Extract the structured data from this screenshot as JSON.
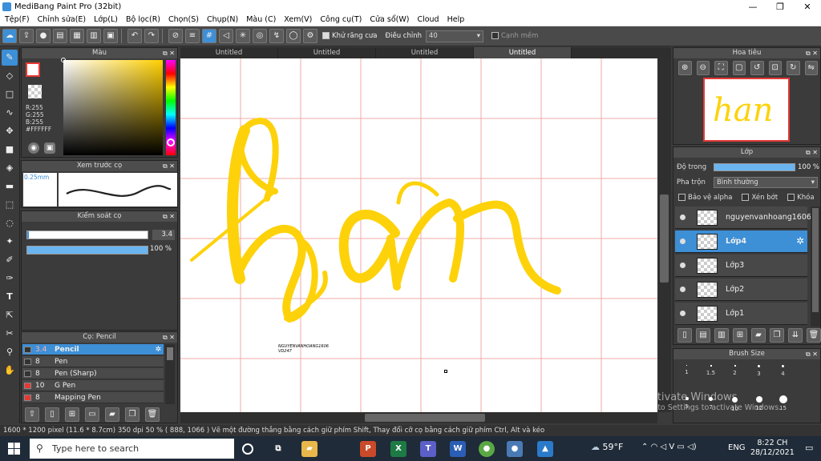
{
  "title": "MediBang Paint Pro (32bit)",
  "menu": [
    "Tệp(F)",
    "Chỉnh sửa(E)",
    "Lớp(L)",
    "Bộ lọc(R)",
    "Chọn(S)",
    "Chụp(N)",
    "Màu (C)",
    "Xem(V)",
    "Công cụ(T)",
    "Cửa sổ(W)",
    "Cloud",
    "Help"
  ],
  "toolbar": {
    "antialias": "Khử răng cưa",
    "adjust_label": "Điều chỉnh",
    "adjust_value": "40",
    "edge": "Cạnh mềm"
  },
  "tabs": [
    "Untitled",
    "Untitled",
    "Untitled",
    "Untitled"
  ],
  "color_panel": {
    "title": "Màu",
    "r": "R:255",
    "g": "G:255",
    "b": "B:255",
    "hex": "#FFFFFF"
  },
  "preview_panel": {
    "title": "Xem trước cọ",
    "size": "0.25mm"
  },
  "brush_ctrl": {
    "title": "Kiểm soát cọ",
    "size": "3.4",
    "opacity": "100 %"
  },
  "brush_list": {
    "title": "Cọ: Pencil",
    "items": [
      {
        "size": "3.4",
        "name": "Pencil",
        "color": "#2b2b2b"
      },
      {
        "size": "8",
        "name": "Pen",
        "color": "#2b2b2b"
      },
      {
        "size": "8",
        "name": "Pen (Sharp)",
        "color": "#2b2b2b"
      },
      {
        "size": "10",
        "name": "G Pen",
        "color": "#e53935"
      },
      {
        "size": "8",
        "name": "Mapping Pen",
        "color": "#e53935"
      }
    ]
  },
  "navigator": {
    "title": "Hoa tiêu"
  },
  "layers": {
    "title": "Lớp",
    "opacity_label": "Độ trong",
    "opacity_value": "100 %",
    "blend_label": "Pha trộn",
    "blend_value": "Bình thường",
    "protect_alpha": "Bảo vệ alpha",
    "clip": "Xén bớt",
    "lock": "Khóa",
    "items": [
      "nguyenvanhoang1606",
      "Lớp4",
      "Lớp3",
      "Lớp2",
      "Lớp1"
    ]
  },
  "brush_size": {
    "title": "Brush Size",
    "row1": [
      "1",
      "1.5",
      "2",
      "3",
      "4"
    ],
    "row2": [
      "5",
      "7",
      "10",
      "12",
      "15"
    ]
  },
  "canvas": {
    "artwork_text": "han",
    "signature_1": "NGUYENVANHOANG1606",
    "signature_2": "VD247"
  },
  "status": "1600 * 1200 pixel   (11.6 * 8.7cm)   350 dpi   50 %   ( 888, 1066 )   Vẽ một đường thẳng bằng cách giữ phím Shift, Thay đổi cỡ cọ bằng cách giữ phím Ctrl, Alt và kéo",
  "watermark": {
    "line1": "Activate Windows",
    "line2": "Go to Settings to activate Windows."
  },
  "taskbar": {
    "search_placeholder": "Type here to search",
    "weather": "59°F",
    "lang": "ENG",
    "time": "8:22 CH",
    "date": "28/12/2021"
  },
  "colors": {
    "accent": "#3d8fd6",
    "artwork": "#fdd20a",
    "grid": "#f2a8a8"
  }
}
